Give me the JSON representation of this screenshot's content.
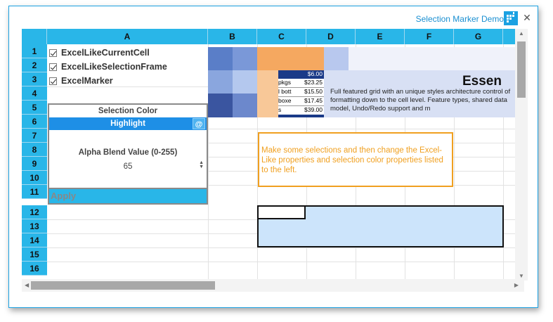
{
  "window": {
    "title": "Selection Marker Demo",
    "close_label": "✕"
  },
  "columns": [
    "A",
    "B",
    "C",
    "D",
    "E",
    "F",
    "G"
  ],
  "rows": [
    "1",
    "2",
    "3",
    "4",
    "5",
    "6",
    "7",
    "8",
    "9",
    "10",
    "11",
    "12",
    "13",
    "14",
    "15",
    "16"
  ],
  "checkboxes": [
    {
      "label": "ExcelLikeCurrentCell",
      "checked": true
    },
    {
      "label": "ExcelLikeSelectionFrame",
      "checked": true
    },
    {
      "label": "ExcelMarker",
      "checked": true
    }
  ],
  "panel": {
    "selection_color_label": "Selection Color",
    "selection_color_value": "Highlight",
    "picker_label": "@",
    "alpha_label": "Alpha Blend Value (0-255)",
    "alpha_value": "65",
    "apply_label": "Apply"
  },
  "image_cells": {
    "prices": [
      "$6.00",
      "$23.25",
      "$15.50",
      "$17.45",
      "$39.00"
    ],
    "items": [
      "pkgs",
      "l bott",
      "boxe",
      "s"
    ],
    "heading": "Essen",
    "description": "Full featured grid with an unique styles architecture control of formatting down to the cell level. Feature types, shared data model, Undo/Redo support and m"
  },
  "note": "Make some selections and then change the Excel-Like properties and selection color properties listed to the left.",
  "colors": {
    "header": "#29b6e8",
    "highlight": "#1e8fe6",
    "note_border": "#f0a020",
    "selection_fill": "#cce4fb"
  }
}
